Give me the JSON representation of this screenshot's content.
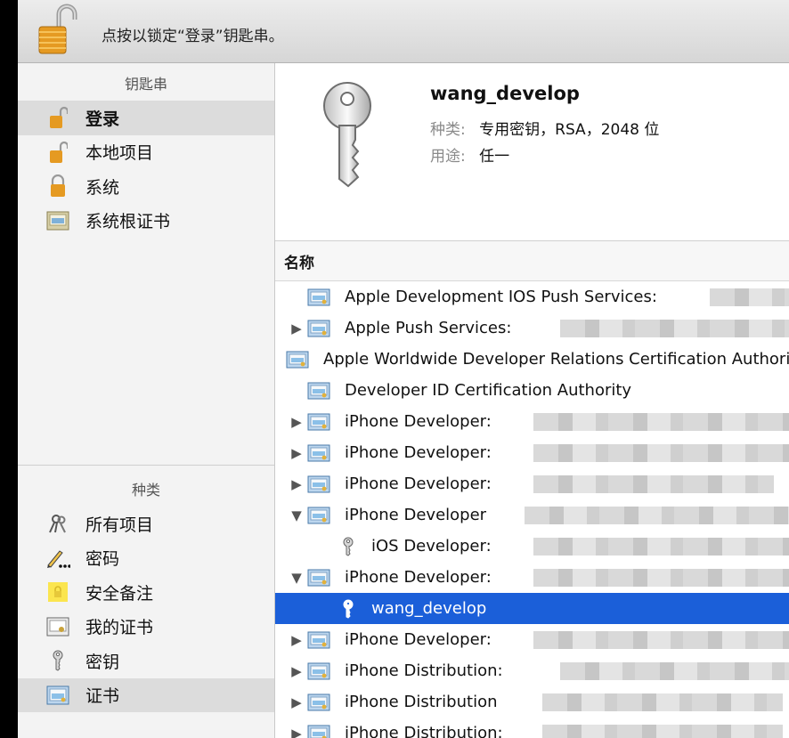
{
  "toolbar": {
    "message": "点按以锁定“登录”钥匙串。"
  },
  "sidebar": {
    "keychains_header": "钥匙串",
    "keychains": [
      {
        "label": "登录",
        "icon": "unlocked-padlock-icon"
      },
      {
        "label": "本地项目",
        "icon": "unlocked-padlock-icon"
      },
      {
        "label": "系统",
        "icon": "locked-padlock-icon"
      },
      {
        "label": "系统根证书",
        "icon": "certificate-cabinet-icon"
      }
    ],
    "categories_header": "种类",
    "categories": [
      {
        "label": "所有项目",
        "icon": "all-items-icon"
      },
      {
        "label": "密码",
        "icon": "pencil-password-icon"
      },
      {
        "label": "安全备注",
        "icon": "secure-note-icon"
      },
      {
        "label": "我的证书",
        "icon": "my-certificate-icon"
      },
      {
        "label": "密钥",
        "icon": "key-icon"
      },
      {
        "label": "证书",
        "icon": "certificate-icon"
      }
    ]
  },
  "detail": {
    "name": "wang_develop",
    "kind_label": "种类:",
    "kind_value": "专用密钥，RSA，2048 位",
    "usage_label": "用途:",
    "usage_value": "任一"
  },
  "list": {
    "column_header": "名称",
    "rows": [
      {
        "label": "Apple Development IOS Push Services:",
        "disclosure": "",
        "type": "cert"
      },
      {
        "label": "Apple Push Services:",
        "disclosure": "▶",
        "type": "cert"
      },
      {
        "label": "Apple Worldwide Developer Relations Certification Authority",
        "disclosure": "",
        "type": "cert"
      },
      {
        "label": "Developer ID Certification Authority",
        "disclosure": "",
        "type": "cert"
      },
      {
        "label": "iPhone Developer:",
        "disclosure": "▶",
        "type": "cert"
      },
      {
        "label": "iPhone Developer:",
        "disclosure": "▶",
        "type": "cert"
      },
      {
        "label": "iPhone Developer:",
        "disclosure": "▶",
        "type": "cert"
      },
      {
        "label": "iPhone Developer",
        "disclosure": "▼",
        "type": "cert"
      },
      {
        "label": "iOS Developer:",
        "disclosure": "",
        "type": "key"
      },
      {
        "label": "iPhone Developer:",
        "disclosure": "▼",
        "type": "cert"
      },
      {
        "label": "wang_develop",
        "disclosure": "",
        "type": "key"
      },
      {
        "label": "iPhone Developer:",
        "disclosure": "▶",
        "type": "cert"
      },
      {
        "label": "iPhone Distribution:",
        "disclosure": "▶",
        "type": "cert"
      },
      {
        "label": "iPhone Distribution",
        "disclosure": "▶",
        "type": "cert"
      },
      {
        "label": "iPhone Distribution:",
        "disclosure": "▶",
        "type": "cert"
      }
    ]
  }
}
